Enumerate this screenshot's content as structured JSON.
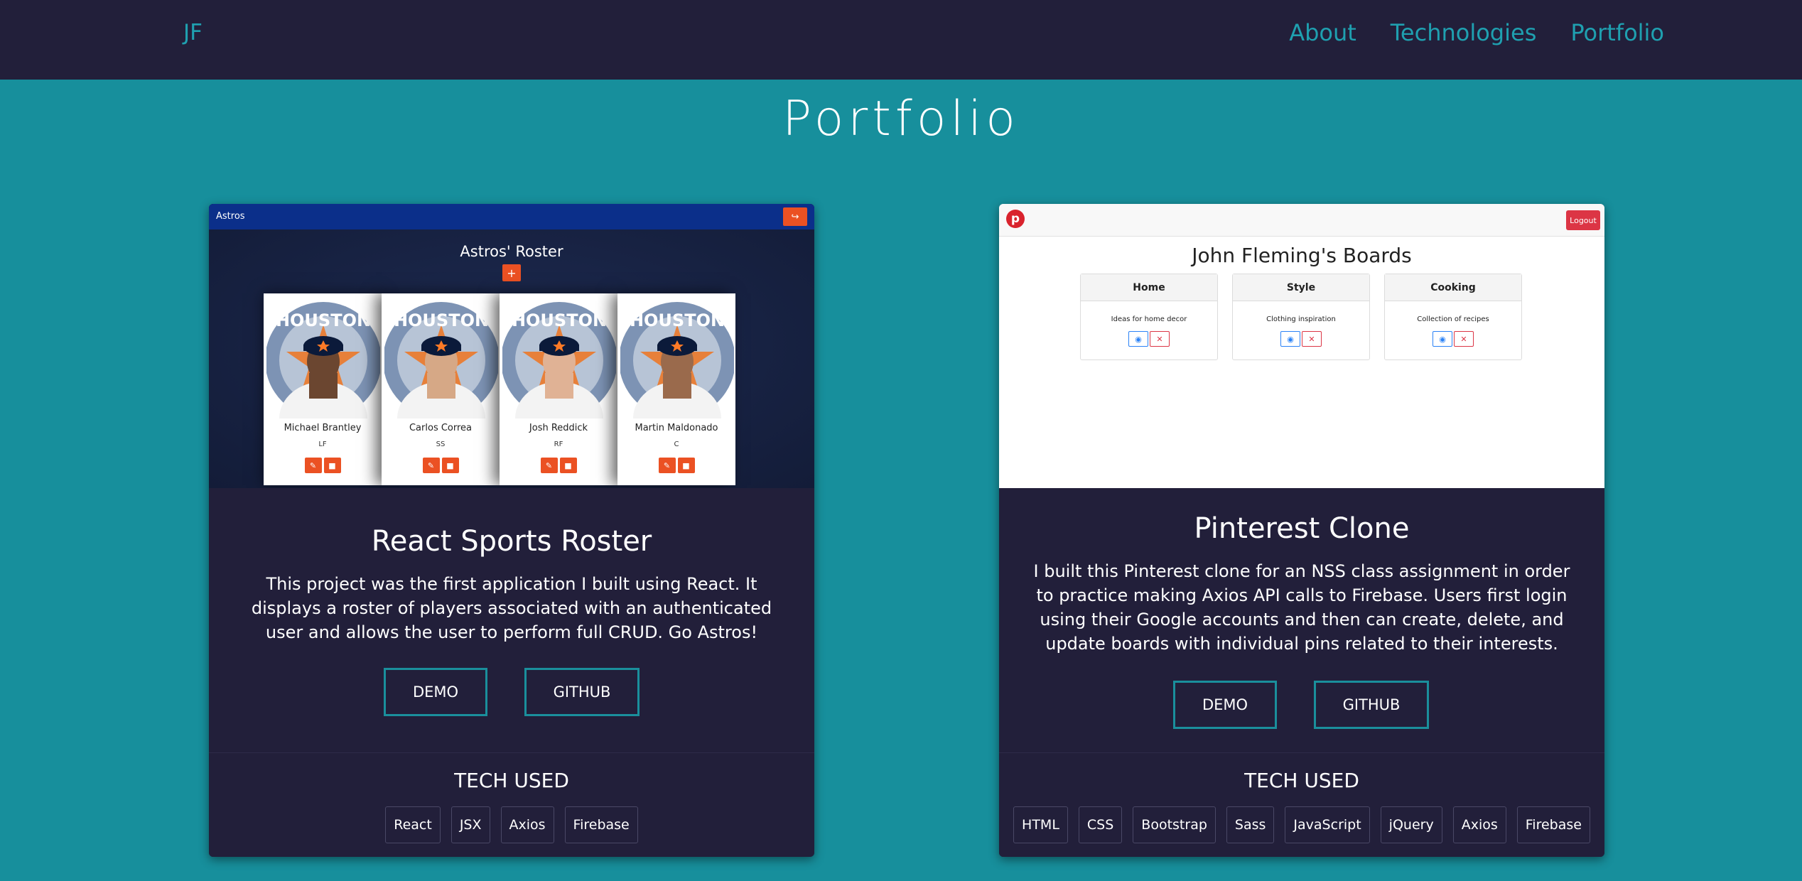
{
  "nav": {
    "brand": "JF",
    "links": [
      "About",
      "Technologies",
      "Portfolio"
    ]
  },
  "page": {
    "title": "Portfolio"
  },
  "colors": {
    "page_bg": "#178f9c",
    "nav_bg": "#221f3a",
    "accent": "#1fa0b0",
    "card_bg": "#221f3a",
    "astros_orange": "#eb5123"
  },
  "projects": [
    {
      "title": "React Sports Roster",
      "description": "This project was the first application I built using React. It displays a roster of players associated with an authenticated user and allows the user to perform full CRUD. Go Astros!",
      "demo_label": "DEMO",
      "github_label": "GITHUB",
      "tech_heading": "TECH USED",
      "tech": [
        "React",
        "JSX",
        "Axios",
        "Firebase"
      ],
      "screenshot": {
        "brand": "Astros",
        "heading": "Astros' Roster",
        "add_label": "+",
        "players": [
          {
            "name": "Michael Brantley",
            "position": "LF"
          },
          {
            "name": "Carlos Correa",
            "position": "SS"
          },
          {
            "name": "Josh Reddick",
            "position": "RF"
          },
          {
            "name": "Martin Maldonado",
            "position": "C"
          }
        ],
        "photo_text": "HOUSTON"
      }
    },
    {
      "title": "Pinterest Clone",
      "description": "I built this Pinterest clone for an NSS class assignment in order to practice making Axios API calls to Firebase. Users first login using their Google accounts and then can create, delete, and update boards with individual pins related to their interests.",
      "demo_label": "DEMO",
      "github_label": "GITHUB",
      "tech_heading": "TECH USED",
      "tech": [
        "HTML",
        "CSS",
        "Bootstrap",
        "Sass",
        "JavaScript",
        "jQuery",
        "Axios",
        "Firebase"
      ],
      "screenshot": {
        "logout_label": "Logout",
        "heading": "John Fleming's Boards",
        "boards": [
          {
            "name": "Home",
            "description": "Ideas for home decor"
          },
          {
            "name": "Style",
            "description": "Clothing inspiration"
          },
          {
            "name": "Cooking",
            "description": "Collection of recipes"
          }
        ]
      }
    }
  ]
}
